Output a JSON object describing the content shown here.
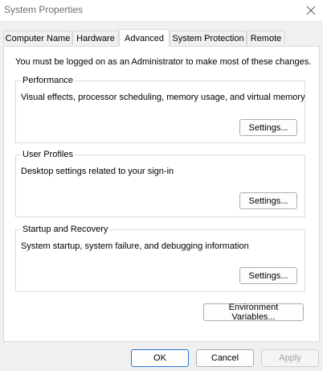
{
  "window": {
    "title": "System Properties",
    "close_icon": "close-icon"
  },
  "tabs": [
    {
      "label": "Computer Name",
      "active": false
    },
    {
      "label": "Hardware",
      "active": false
    },
    {
      "label": "Advanced",
      "active": true
    },
    {
      "label": "System Protection",
      "active": false
    },
    {
      "label": "Remote",
      "active": false
    }
  ],
  "advanced": {
    "admin_note": "You must be logged on as an Administrator to make most of these changes.",
    "performance": {
      "title": "Performance",
      "description": "Visual effects, processor scheduling, memory usage, and virtual memory",
      "button": "Settings..."
    },
    "user_profiles": {
      "title": "User Profiles",
      "description": "Desktop settings related to your sign-in",
      "button": "Settings..."
    },
    "startup_recovery": {
      "title": "Startup and Recovery",
      "description": "System startup, system failure, and debugging information",
      "button": "Settings..."
    },
    "env_button": "Environment Variables..."
  },
  "footer": {
    "ok": "OK",
    "cancel": "Cancel",
    "apply": "Apply"
  }
}
